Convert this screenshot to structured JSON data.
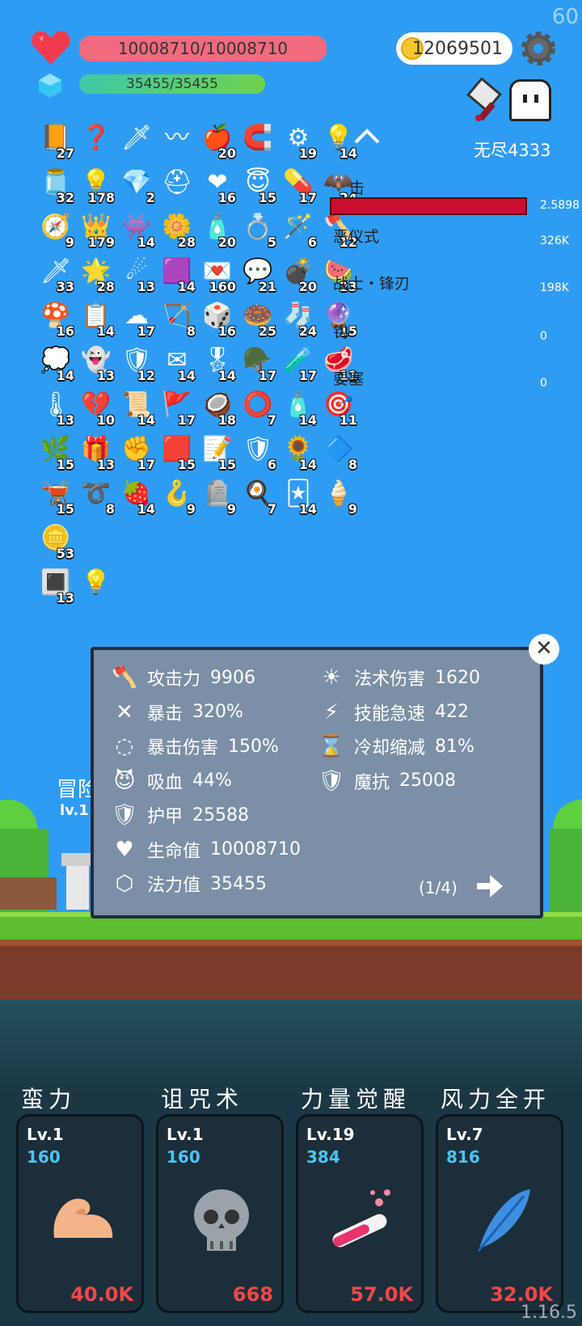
{
  "fps": "60",
  "version": "1.16.5",
  "hp": {
    "text": "10008710/10008710",
    "color": "#f16a7e"
  },
  "mp": {
    "text": "35455/35455"
  },
  "gold": "12069501",
  "mode": "无尽4333",
  "inventory": [
    [
      {
        "icon": "book",
        "emoji": "📙",
        "count": "27"
      },
      {
        "icon": "hook",
        "emoji": "❓",
        "count": ""
      },
      {
        "icon": "sword",
        "emoji": "🗡",
        "count": ""
      },
      {
        "icon": "beads",
        "emoji": "〰",
        "count": ""
      },
      {
        "icon": "apple",
        "emoji": "🍎",
        "count": "20"
      },
      {
        "icon": "magnet",
        "emoji": "🧲",
        "count": ""
      },
      {
        "icon": "spike-ball",
        "emoji": "⚙",
        "count": "19"
      },
      {
        "icon": "bulb",
        "emoji": "💡",
        "count": "14"
      }
    ],
    [
      {
        "icon": "jam",
        "emoji": "🫙",
        "count": "32"
      },
      {
        "icon": "bulb-bomb",
        "emoji": "💡",
        "count": "178"
      },
      {
        "icon": "diamond",
        "emoji": "💎",
        "count": "2"
      },
      {
        "icon": "viking-helmet",
        "emoji": "⛑",
        "count": ""
      },
      {
        "icon": "heart",
        "emoji": "❤",
        "count": "16"
      },
      {
        "icon": "halo",
        "emoji": "😇",
        "count": "15"
      },
      {
        "icon": "pill",
        "emoji": "💊",
        "count": "17"
      },
      {
        "icon": "bat",
        "emoji": "🦇",
        "count": "24"
      }
    ],
    [
      {
        "icon": "compass",
        "emoji": "🧭",
        "count": "9"
      },
      {
        "icon": "crown",
        "emoji": "👑",
        "count": "179"
      },
      {
        "icon": "slime",
        "emoji": "👾",
        "count": "14"
      },
      {
        "icon": "flower",
        "emoji": "🌼",
        "count": "28"
      },
      {
        "icon": "eraser",
        "emoji": "🧴",
        "count": "20"
      },
      {
        "icon": "ring",
        "emoji": "💍",
        "count": "5"
      },
      {
        "icon": "wand",
        "emoji": "🪄",
        "count": "6"
      },
      {
        "icon": "axe",
        "emoji": "🪓",
        "count": "12"
      }
    ],
    [
      {
        "icon": "blade",
        "emoji": "🗡",
        "count": "33"
      },
      {
        "icon": "star-card",
        "emoji": "🌟",
        "count": "28"
      },
      {
        "icon": "comet",
        "emoji": "☄",
        "count": "13"
      },
      {
        "icon": "cube",
        "emoji": "🟪",
        "count": "14"
      },
      {
        "icon": "envelope-heart",
        "emoji": "💌",
        "count": "160"
      },
      {
        "icon": "chat",
        "emoji": "💬",
        "count": "21"
      },
      {
        "icon": "grenade",
        "emoji": "💣",
        "count": "20"
      },
      {
        "icon": "watermelon",
        "emoji": "🍉",
        "count": "23"
      }
    ],
    [
      {
        "icon": "mushroom",
        "emoji": "🍄",
        "count": "16"
      },
      {
        "icon": "clipboard",
        "emoji": "📋",
        "count": "14"
      },
      {
        "icon": "cloud",
        "emoji": "☁",
        "count": "17"
      },
      {
        "icon": "bow",
        "emoji": "🏹",
        "count": "8"
      },
      {
        "icon": "dice",
        "emoji": "🎲",
        "count": "16"
      },
      {
        "icon": "donut",
        "emoji": "🍩",
        "count": "25"
      },
      {
        "icon": "sock",
        "emoji": "🧦",
        "count": "24"
      },
      {
        "icon": "orb",
        "emoji": "🔮",
        "count": "15"
      }
    ],
    [
      {
        "icon": "speech",
        "emoji": "💭",
        "count": "14"
      },
      {
        "icon": "ghost",
        "emoji": "👻",
        "count": "13"
      },
      {
        "icon": "shield-star",
        "emoji": "🛡",
        "count": "12"
      },
      {
        "icon": "mail",
        "emoji": "✉",
        "count": "14"
      },
      {
        "icon": "badge",
        "emoji": "🎖",
        "count": "14"
      },
      {
        "icon": "helmet",
        "emoji": "🪖",
        "count": "17"
      },
      {
        "icon": "potion",
        "emoji": "🧪",
        "count": "17"
      },
      {
        "icon": "meat",
        "emoji": "🥩",
        "count": "11"
      }
    ],
    [
      {
        "icon": "thermometer",
        "emoji": "🌡",
        "count": "13"
      },
      {
        "icon": "broken-heart",
        "emoji": "💔",
        "count": "10"
      },
      {
        "icon": "scroll",
        "emoji": "📜",
        "count": "14"
      },
      {
        "icon": "flag",
        "emoji": "🚩",
        "count": "17"
      },
      {
        "icon": "coconut",
        "emoji": "🥥",
        "count": "18"
      },
      {
        "icon": "target-ring",
        "emoji": "⭕",
        "count": "7"
      },
      {
        "icon": "spray",
        "emoji": "🧴",
        "count": "14"
      },
      {
        "icon": "crosshair",
        "emoji": "🎯",
        "count": "11"
      }
    ],
    [
      {
        "icon": "leaf-drop",
        "emoji": "🌿",
        "count": "15"
      },
      {
        "icon": "gift",
        "emoji": "🎁",
        "count": "13"
      },
      {
        "icon": "fist",
        "emoji": "✊",
        "count": "17"
      },
      {
        "icon": "red-card",
        "emoji": "🟥",
        "count": "15"
      },
      {
        "icon": "note",
        "emoji": "📝",
        "count": "15"
      },
      {
        "icon": "shield",
        "emoji": "🛡",
        "count": "6"
      },
      {
        "icon": "sunflower",
        "emoji": "🌻",
        "count": "14"
      },
      {
        "icon": "gem",
        "emoji": "🔷",
        "count": "8"
      }
    ],
    [
      {
        "icon": "cauldron",
        "emoji": "🫕",
        "count": "15"
      },
      {
        "icon": "noose",
        "emoji": "➰",
        "count": "8"
      },
      {
        "icon": "strawberry",
        "emoji": "🍓",
        "count": "14"
      },
      {
        "icon": "fishhook",
        "emoji": "🪝",
        "count": "9"
      },
      {
        "icon": "tombstone",
        "emoji": "🪦",
        "count": "9"
      },
      {
        "icon": "egg",
        "emoji": "🍳",
        "count": "7"
      },
      {
        "icon": "cards",
        "emoji": "🃏",
        "count": "14"
      },
      {
        "icon": "icecream",
        "emoji": "🍦",
        "count": "9"
      }
    ],
    [
      {
        "icon": "coins",
        "emoji": "🪙",
        "count": "53"
      }
    ],
    [
      {
        "icon": "chain-box",
        "emoji": "🔳",
        "count": "13"
      },
      {
        "icon": "bulb-box",
        "emoji": "💡",
        "count": ""
      }
    ]
  ],
  "damage": [
    {
      "label": "击",
      "value": "2.5898"
    },
    {
      "label": "恶仪式",
      "value": "326K"
    },
    {
      "label": "战士・锋刃",
      "value": "198K"
    },
    {
      "label": "钩",
      "value": "0"
    },
    {
      "label": "要塞",
      "value": "0"
    }
  ],
  "player": {
    "name": "冒险",
    "level": "lv.1"
  },
  "stats_left": [
    {
      "icon": "axe-icon",
      "label": "攻击力",
      "value": "9906"
    },
    {
      "icon": "crit-icon",
      "label": "暴击",
      "value": "320%"
    },
    {
      "icon": "crit-damage-icon",
      "label": "暴击伤害",
      "value": "150%"
    },
    {
      "icon": "lifesteal-icon",
      "label": "吸血",
      "value": "44%"
    },
    {
      "icon": "armor-icon",
      "label": "护甲",
      "value": "25588"
    },
    {
      "icon": "heart-icon",
      "label": "生命值",
      "value": "10008710"
    },
    {
      "icon": "mana-icon",
      "label": "法力值",
      "value": "35455"
    }
  ],
  "stats_right": [
    {
      "icon": "sun-icon",
      "label": "法术伤害",
      "value": "1620"
    },
    {
      "icon": "lightning-icon",
      "label": "技能急速",
      "value": "422"
    },
    {
      "icon": "hourglass-icon",
      "label": "冷却缩减",
      "value": "81%"
    },
    {
      "icon": "magic-resist-icon",
      "label": "魔抗",
      "value": "25008"
    }
  ],
  "page": "(1/4)",
  "skills": [
    {
      "name": "蛮力",
      "level": "Lv.1",
      "power": "160",
      "cost": "40.0K",
      "icon": "muscle-icon"
    },
    {
      "name": "诅咒术",
      "level": "Lv.1",
      "power": "160",
      "cost": "668",
      "icon": "skull-icon"
    },
    {
      "name": "力量觉醒",
      "level": "Lv.19",
      "power": "384",
      "cost": "57.0K",
      "icon": "test-tube-icon"
    },
    {
      "name": "风力全开",
      "level": "Lv.7",
      "power": "816",
      "cost": "32.0K",
      "icon": "feather-icon"
    }
  ]
}
